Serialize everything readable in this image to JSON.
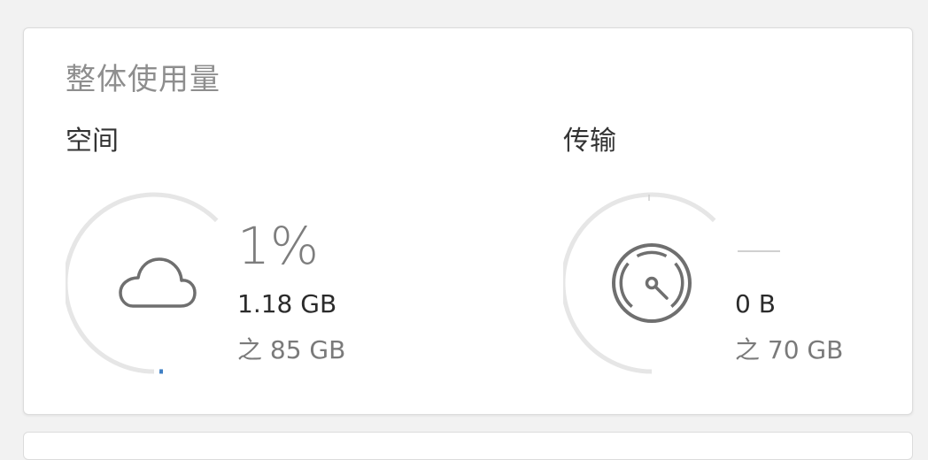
{
  "panel": {
    "title": "整体使用量"
  },
  "storage": {
    "label": "空间",
    "icon": "cloud-icon",
    "percent_text": "1%",
    "percent_value": 1,
    "used": "1.18 GB",
    "total": "之 85 GB"
  },
  "transfer": {
    "label": "传输",
    "icon": "speedometer-icon",
    "percent_text": "",
    "used": "0 B",
    "total": "之 70 GB"
  },
  "colors": {
    "track": "#e6e6e6",
    "progress": "#3f7fc4",
    "icon": "#6f6f6f"
  }
}
